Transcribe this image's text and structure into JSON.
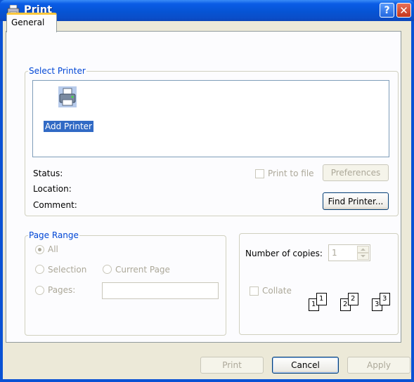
{
  "window": {
    "title": "Print",
    "help_glyph": "?",
    "close_glyph": "✕"
  },
  "tabs": [
    {
      "label": "General"
    }
  ],
  "select_printer": {
    "legend": "Select Printer",
    "printers": [
      {
        "label": "Add Printer",
        "icon": "add-printer-icon",
        "selected": true
      }
    ],
    "status_label": "Status:",
    "location_label": "Location:",
    "comment_label": "Comment:",
    "print_to_file_label": "Print to file",
    "preferences_label": "Preferences",
    "find_printer_label": "Find Printer..."
  },
  "page_range": {
    "legend": "Page Range",
    "all_label": "All",
    "selection_label": "Selection",
    "current_page_label": "Current Page",
    "pages_label": "Pages:",
    "pages_value": ""
  },
  "copies": {
    "number_of_copies_label": "Number of copies:",
    "copies_value": "1",
    "collate_label": "Collate",
    "collate_pages": [
      "1",
      "1",
      "2",
      "2",
      "3",
      "3"
    ]
  },
  "footer": {
    "print_label": "Print",
    "cancel_label": "Cancel",
    "apply_label": "Apply"
  },
  "colors": {
    "titlebar": "#0a52d4",
    "legend_text": "#0046d5",
    "selection": "#316ac5",
    "face": "#ece9d8"
  }
}
